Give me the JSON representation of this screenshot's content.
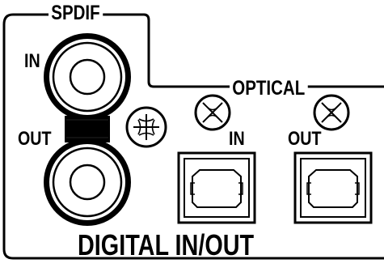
{
  "panel": {
    "spdif_label": "SPDIF",
    "spdif_in_label": "IN",
    "spdif_out_label": "OUT",
    "optical_label": "OPTICAL",
    "optical_in_label": "IN",
    "optical_out_label": "OUT",
    "title": "DIGITAL IN/OUT"
  }
}
